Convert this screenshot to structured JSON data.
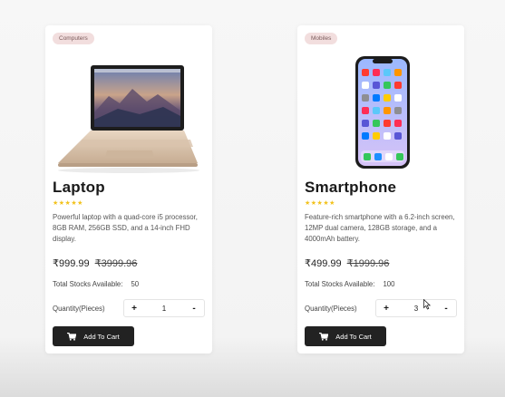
{
  "products": [
    {
      "category": "Computers",
      "title": "Laptop",
      "stars": "★★★★★",
      "description": "Powerful laptop with a quad-core i5 processor, 8GB RAM, 256GB SSD, and a 14-inch FHD display.",
      "price": "₹999.99",
      "old_price": "₹3999.96",
      "stock_label": "Total Stocks Available:",
      "stock_value": "50",
      "quantity_label": "Quantity(Pieces)",
      "quantity_value": "1",
      "plus_label": "+",
      "minus_label": "-",
      "cart_label": "Add To Cart",
      "image_icon": "laptop-image"
    },
    {
      "category": "Mobiles",
      "title": "Smartphone",
      "stars": "★★★★★",
      "description": "Feature-rich smartphone with a 6.2-inch screen, 12MP dual camera, 128GB storage, and a 4000mAh battery.",
      "price": "₹499.99",
      "old_price": "₹1999.96",
      "stock_label": "Total Stocks Available:",
      "stock_value": "100",
      "quantity_label": "Quantity(Pieces)",
      "quantity_value": "3",
      "plus_label": "+",
      "minus_label": "-",
      "cart_label": "Add To Cart",
      "image_icon": "smartphone-image"
    }
  ],
  "colors": {
    "badge_bg": "#f2dede",
    "star": "#f2c21b",
    "button_bg": "#222222"
  }
}
